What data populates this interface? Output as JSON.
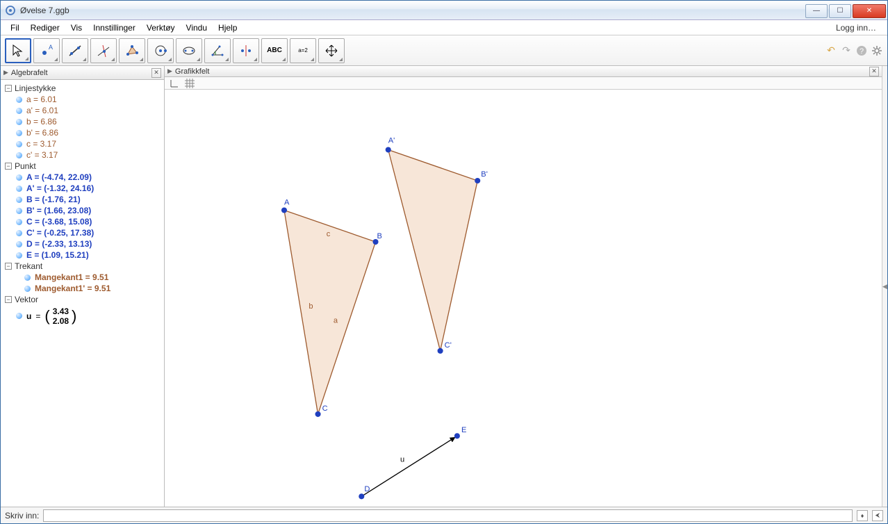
{
  "window": {
    "title": "Øvelse 7.ggb"
  },
  "menu": {
    "fil": "Fil",
    "rediger": "Rediger",
    "vis": "Vis",
    "innstillinger": "Innstillinger",
    "verktoy": "Verktøy",
    "vindu": "Vindu",
    "hjelp": "Hjelp",
    "login": "Logg inn…"
  },
  "toolbar": {
    "text_label": "ABC",
    "slider_label": "a=2"
  },
  "panels": {
    "algebra": "Algebrafelt",
    "graphics": "Grafikkfelt"
  },
  "algebra": {
    "groups": {
      "linjestykke": {
        "label": "Linjestykke",
        "items": [
          {
            "text": "a = 6.01",
            "cls": "c-brown"
          },
          {
            "text": "a' = 6.01",
            "cls": "c-brown"
          },
          {
            "text": "b = 6.86",
            "cls": "c-brown"
          },
          {
            "text": "b' = 6.86",
            "cls": "c-brown"
          },
          {
            "text": "c = 3.17",
            "cls": "c-brown"
          },
          {
            "text": "c' = 3.17",
            "cls": "c-brown"
          }
        ]
      },
      "punkt": {
        "label": "Punkt",
        "items": [
          {
            "text": "A = (-4.74, 22.09)",
            "cls": "c-blue"
          },
          {
            "text": "A' = (-1.32, 24.16)",
            "cls": "c-blue"
          },
          {
            "text": "B = (-1.76, 21)",
            "cls": "c-blue"
          },
          {
            "text": "B' = (1.66, 23.08)",
            "cls": "c-blue"
          },
          {
            "text": "C = (-3.68, 15.08)",
            "cls": "c-blue"
          },
          {
            "text": "C' = (-0.25, 17.38)",
            "cls": "c-blue"
          },
          {
            "text": "D = (-2.33, 13.13)",
            "cls": "c-blue"
          },
          {
            "text": "E = (1.09, 15.21)",
            "cls": "c-blue"
          }
        ]
      },
      "trekant": {
        "label": "Trekant",
        "items": [
          {
            "text": "Mangekant1 = 9.51",
            "cls": "c-brown"
          },
          {
            "text": "Mangekant1' = 9.51",
            "cls": "c-brown"
          }
        ]
      },
      "vektor": {
        "label": "Vektor",
        "u_name": "u",
        "u_eq": "=",
        "u1": "3.43",
        "u2": "2.08"
      }
    }
  },
  "canvas": {
    "labels": {
      "A": "A",
      "Ap": "A'",
      "B": "B",
      "Bp": "B'",
      "C": "C",
      "Cp": "C'",
      "D": "D",
      "E": "E",
      "a": "a",
      "b": "b",
      "c": "c",
      "u": "u"
    }
  },
  "inputbar": {
    "label": "Skriv inn:"
  }
}
